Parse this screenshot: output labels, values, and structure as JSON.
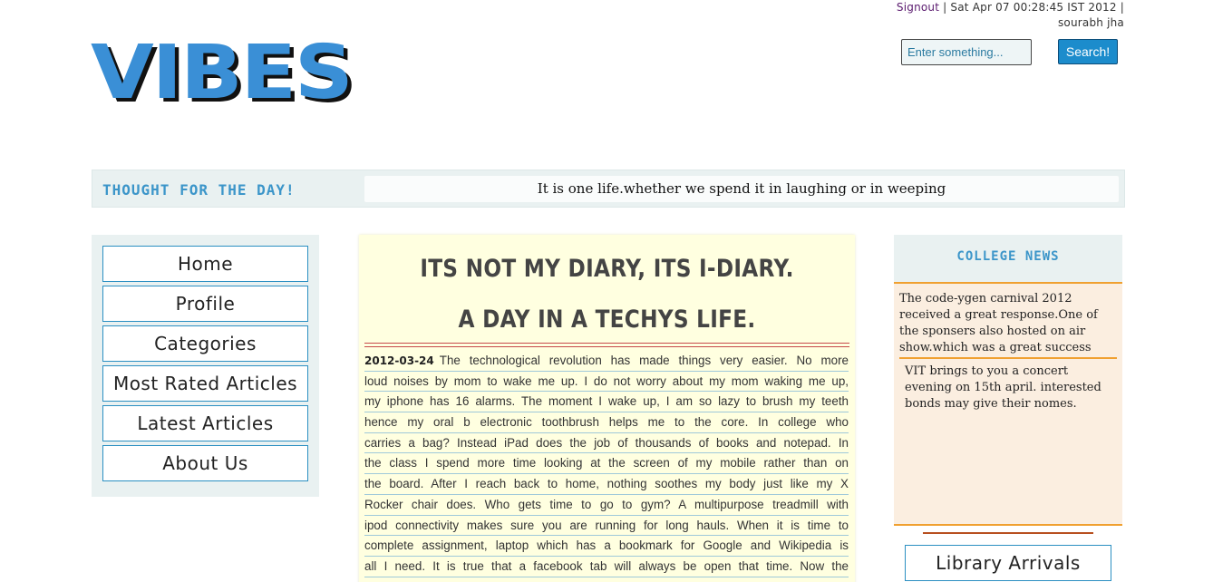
{
  "header": {
    "signout_label": "Signout",
    "separator": "|",
    "datetime": "Sat Apr 07 00:28:45 IST 2012",
    "username": "sourabh jha",
    "search_placeholder": "Enter something...",
    "search_button_label": "Search!",
    "logo_text": "VIBES"
  },
  "thought": {
    "label": "THOUGHT FOR THE DAY!",
    "text": "It is one life.whether we spend it in laughing or in weeping"
  },
  "sidebar": {
    "items": [
      {
        "label": "Home"
      },
      {
        "label": "Profile"
      },
      {
        "label": "Categories"
      },
      {
        "label": "Most Rated Articles"
      },
      {
        "label": "Latest Articles"
      },
      {
        "label": "About Us"
      }
    ]
  },
  "article": {
    "title": "ITS NOT MY DIARY, ITS I-DIARY. A DAY IN A TECHYS LIFE.",
    "date": "2012-03-24",
    "lines": [
      "The technological revolution has made things very easier. No more",
      "loud noises by mom to wake me up. I do not worry about my mom waking me up,",
      "my iphone has 16 alarms. The moment I wake up, I am so lazy to brush my teeth",
      "hence my oral b electronic toothbrush helps me to the core. In college who",
      "carries a bag? Instead iPad does the job of thousands of books and notepad. In",
      "the class I spend more time looking at the screen of my mobile rather than on",
      "the board. After I reach back to home, nothing soothes my body just like my X",
      "Rocker chair does. Who gets time to go to gym? A multipurpose treadmill with",
      "ipod connectivity makes sure you are running for long hauls. When it is time to",
      "complete assignment, laptop which has a bookmark for Google and Wikipedia is",
      "all I need. It is true that a facebook tab will always be open that time. Now the"
    ]
  },
  "news": {
    "heading": "COLLEGE NEWS",
    "items": [
      "The code-ygen carnival 2012 received a great response.One of the sponsers also hosted on air show.which was a great success",
      "VIT brings to you a concert evening on 15th april. interested bonds may give their nomes."
    ]
  },
  "library": {
    "label": "Library Arrivals"
  }
}
